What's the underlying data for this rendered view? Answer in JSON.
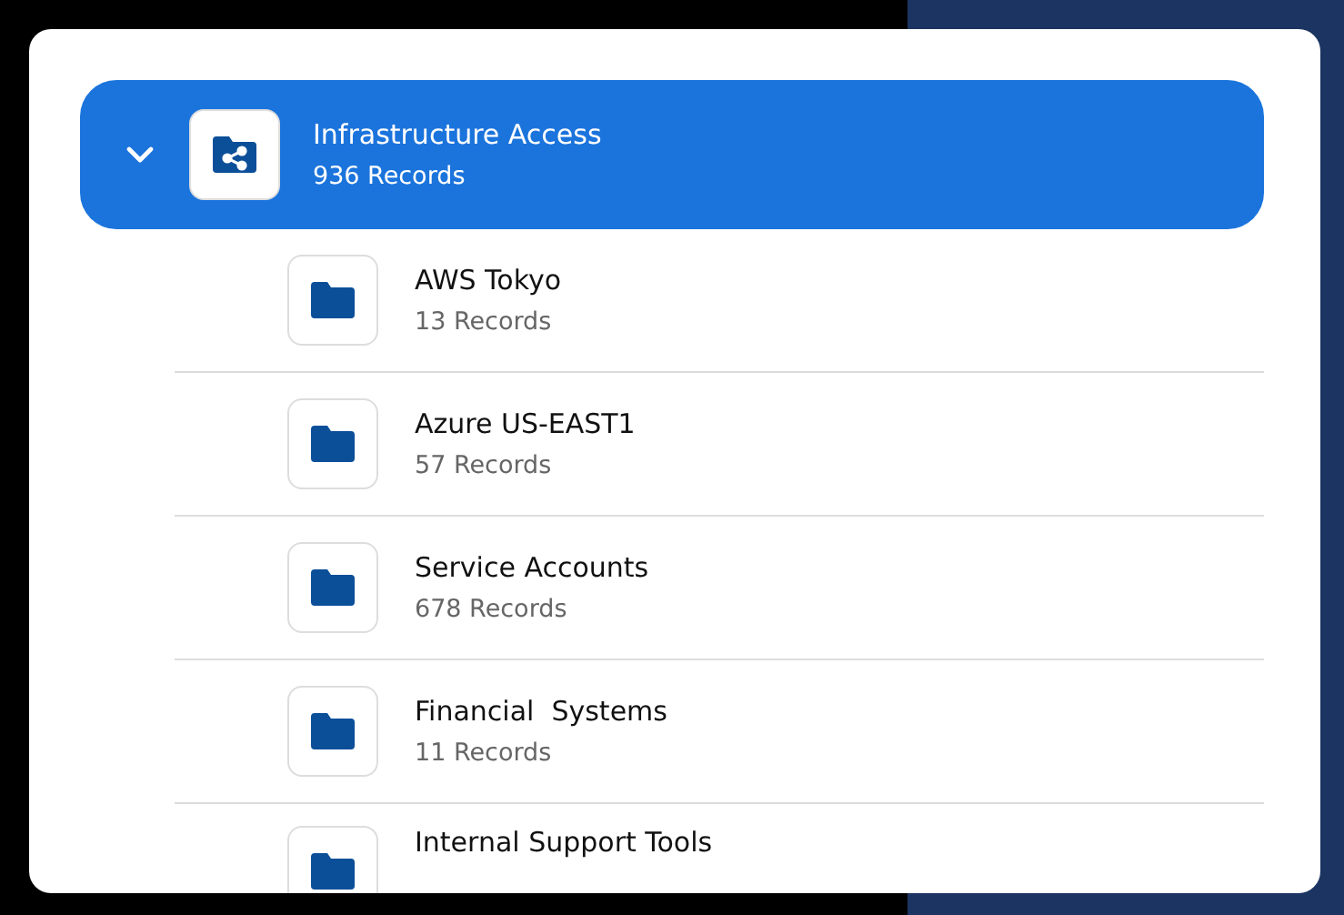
{
  "group": {
    "title": "Infrastructure Access",
    "count": "936 Records",
    "expanded": true,
    "selected": true
  },
  "children": [
    {
      "title": "AWS Tokyo",
      "count": "13 Records"
    },
    {
      "title": "Azure US-EAST1",
      "count": "57 Records"
    },
    {
      "title": "Service Accounts",
      "count": "678 Records"
    },
    {
      "title": "Financial  Systems",
      "count": "11 Records"
    },
    {
      "title": "Internal Support Tools"
    }
  ]
}
